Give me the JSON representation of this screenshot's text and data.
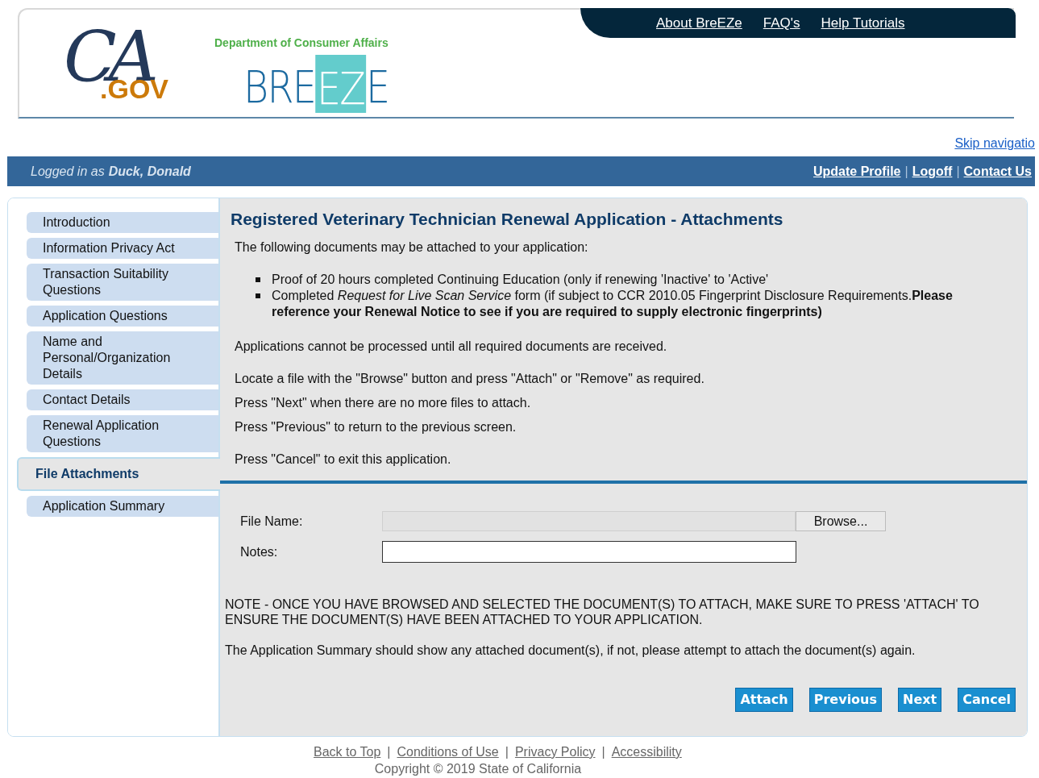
{
  "header": {
    "ca_logo": {
      "script": "CA",
      "domain": ".GOV"
    },
    "department": "Department of Consumer Affairs",
    "breeze_logo": [
      "BRE",
      "EZ",
      "E"
    ],
    "top_links": [
      "About BreEZe",
      "FAQ's",
      "Help Tutorials"
    ]
  },
  "skip_link": "Skip navigatio",
  "user_bar": {
    "prefix": "Logged in as",
    "user": "Duck, Donald",
    "links": [
      "Update Profile",
      "Logoff",
      "Contact Us"
    ],
    "separators": [
      "|",
      "|"
    ]
  },
  "sidebar": {
    "items": [
      {
        "label": "Introduction",
        "selected": false
      },
      {
        "label": "Information Privacy Act",
        "selected": false
      },
      {
        "label": "Transaction Suitability Questions",
        "selected": false
      },
      {
        "label": "Application Questions",
        "selected": false
      },
      {
        "label": "Name and Personal/Organization Details",
        "selected": false
      },
      {
        "label": "Contact Details",
        "selected": false
      },
      {
        "label": "Renewal Application Questions",
        "selected": false
      },
      {
        "label": "File Attachments",
        "selected": true
      },
      {
        "label": "Application Summary",
        "selected": false
      }
    ]
  },
  "content": {
    "title": "Registered Veterinary Technician Renewal Application - Attachments",
    "intro": "The following documents may be attached to your application:",
    "bullets": [
      "Proof of 20 hours completed Continuing Education (only if renewing 'Inactive' to 'Active'",
      "Completed *Request for Live Scan Service* form (if subject to CCR 2010.05 Fingerprint Disclosure Requirements.**Please reference your Renewal Notice to see if you are required to supply electronic fingerprints)**"
    ],
    "paragraphs": [
      "Applications cannot be processed until all required documents are received.",
      "Locate a file with the \"Browse\" button and press \"Attach\" or \"Remove\" as required.",
      "Press \"Next\" when there are no more files to attach.",
      "Press \"Previous\" to return to the previous screen.",
      "Press \"Cancel\" to exit this application."
    ]
  },
  "form": {
    "file_label": "File Name:",
    "browse_button": "Browse...",
    "notes_label": "Notes:",
    "note": "NOTE - ONCE YOU HAVE BROWSED AND SELECTED THE DOCUMENT(S) TO ATTACH, MAKE SURE TO PRESS 'ATTACH' TO ENSURE THE DOCUMENT(S) HAVE BEEN ATTACHED TO YOUR APPLICATION.",
    "summary_note": "The Application Summary should show any attached document(s), if not, please attempt to attach the document(s) again.",
    "buttons": [
      "Attach",
      "Previous",
      "Next",
      "Cancel"
    ]
  },
  "footer": {
    "links": [
      "Back to Top",
      "Conditions of Use",
      "Privacy Policy",
      "Accessibility"
    ],
    "separators": [
      "|",
      "|",
      "|"
    ],
    "copyright": "Copyright © 2019 State of California"
  }
}
